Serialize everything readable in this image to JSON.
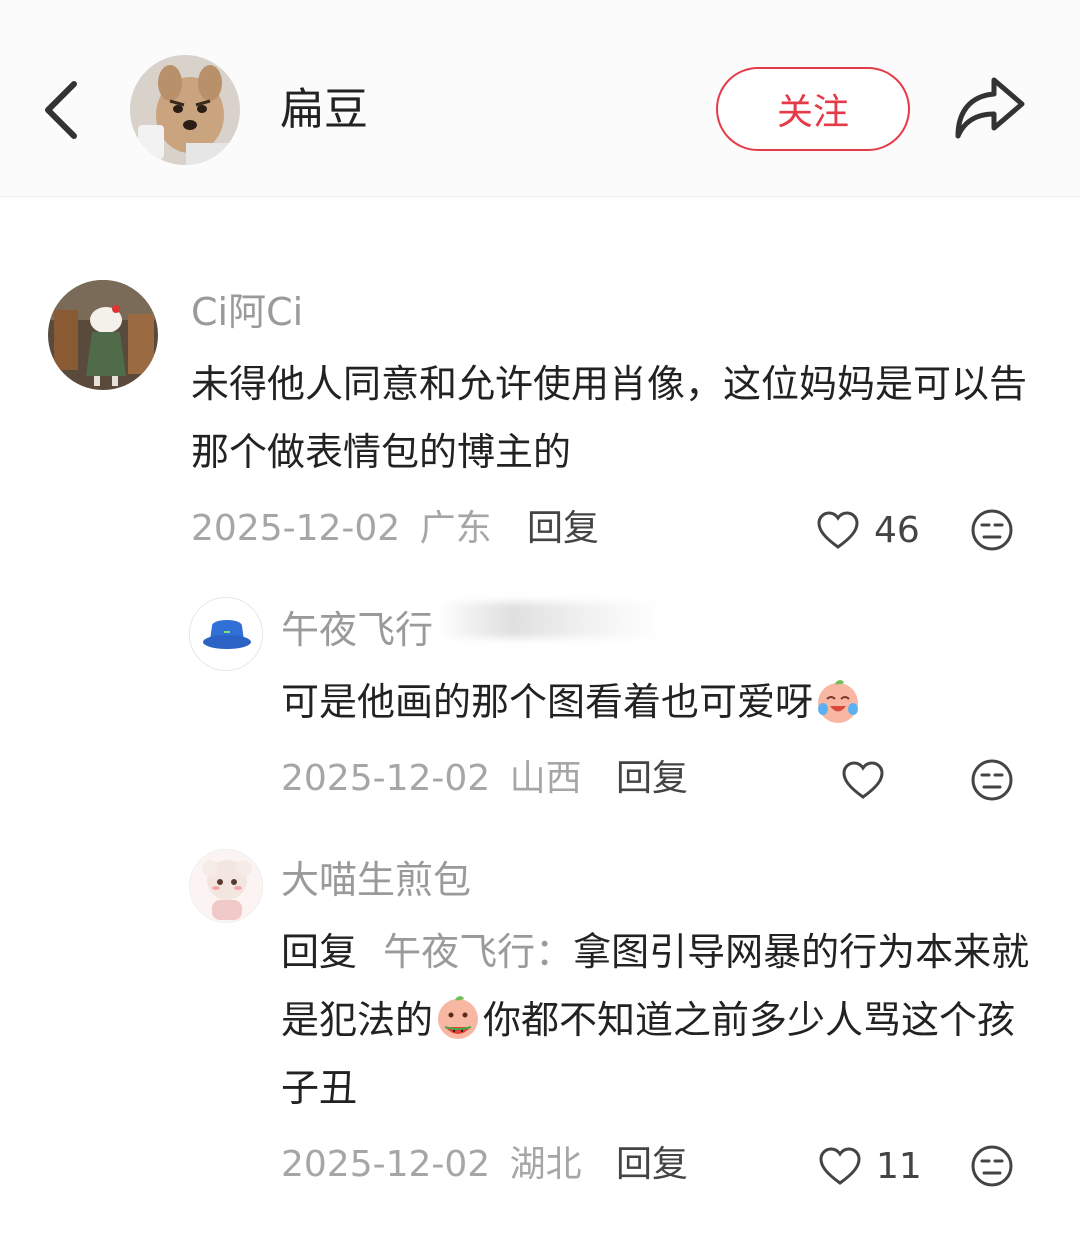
{
  "header": {
    "username": "扁豆",
    "follow_label": "关注"
  },
  "comments": [
    {
      "username": "Ci阿Ci",
      "text": "未得他人同意和允许使用肖像，这位妈妈是可以告那个做表情包的博主的",
      "date": "2025-12-02",
      "location": "广东",
      "reply_label": "回复",
      "likes": "46"
    }
  ],
  "replies": [
    {
      "username": "午夜飞行",
      "text": "可是他画的那个图看着也可爱呀",
      "date": "2025-12-02",
      "location": "山西",
      "reply_label": "回复",
      "likes": ""
    },
    {
      "username": "大喵生煎包",
      "reply_prefix": "回复",
      "reply_target": "午夜飞行：",
      "text_part1": "拿图引导网暴的行为本来就是犯法的",
      "text_part2": "你都不知道之前多少人骂这个孩子丑",
      "date": "2025-12-02",
      "location": "湖北",
      "reply_label": "回复",
      "likes": "11"
    }
  ],
  "colors": {
    "accent": "#e53a48",
    "meta_gray": "#a6a6a6",
    "name_gray": "#9a9a9a"
  },
  "icons": [
    "back-chevron-icon",
    "share-arrow-icon",
    "heart-icon",
    "dislike-face-icon",
    "crying-laughing-emoji-icon",
    "eating-watermelon-emoji-icon"
  ]
}
